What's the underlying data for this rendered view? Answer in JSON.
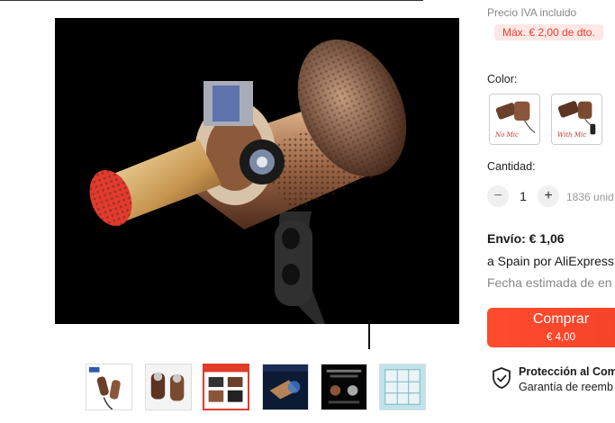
{
  "product": {
    "image_alt": "In-ear earphone cutaway render",
    "thumbnails": [
      {
        "name": "thumb-earphone-pair",
        "active": false
      },
      {
        "name": "thumb-earphone-closeup",
        "active": false
      },
      {
        "name": "thumb-product-features",
        "active": true
      },
      {
        "name": "thumb-blue-render",
        "active": false
      },
      {
        "name": "thumb-dark-infographic",
        "active": false
      },
      {
        "name": "thumb-size-chart",
        "active": false
      }
    ]
  },
  "pricing": {
    "tax_note": "Precio IVA incluido",
    "discount_tag": "Máx. € 2,00 de dto."
  },
  "color": {
    "label": "Color:",
    "options": [
      {
        "label": "No Mic"
      },
      {
        "label": "With Mic"
      }
    ]
  },
  "quantity": {
    "label": "Cantidad:",
    "value": "1",
    "minus": "−",
    "plus": "+",
    "available": "1836 unid"
  },
  "shipping": {
    "title": "Envío: € 1,06",
    "destination": "a Spain por AliExpress",
    "date": "Fecha estimada de en"
  },
  "buy": {
    "label": "Comprar",
    "price": "€ 4,00"
  },
  "protection": {
    "title": "Protección al Com",
    "subtitle": "Garantía de reemb"
  }
}
